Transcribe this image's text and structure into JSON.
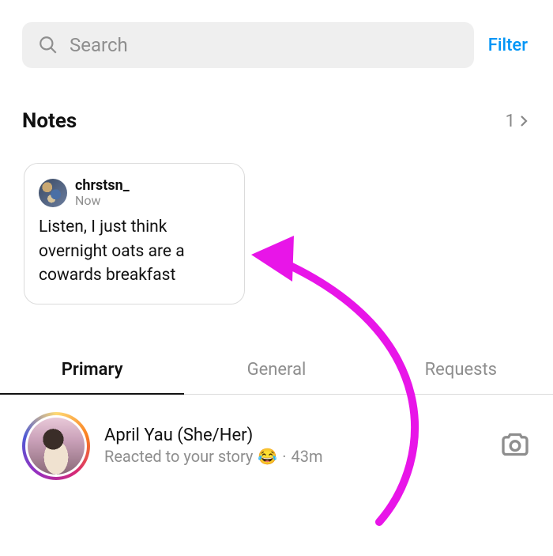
{
  "search": {
    "placeholder": "Search"
  },
  "filter_label": "Filter",
  "notes": {
    "title": "Notes",
    "count": "1",
    "card": {
      "username": "chrstsn_",
      "time": "Now",
      "body": "Listen, I just think overnight oats are a cowards breakfast"
    }
  },
  "tabs": {
    "primary": "Primary",
    "general": "General",
    "requests": "Requests"
  },
  "dm": {
    "name": "April Yau (She/Her)",
    "subtitle": "Reacted to your story",
    "emoji": "😂",
    "sep": "·",
    "time": "43m"
  },
  "colors": {
    "accent": "#0095f6",
    "annot": "#e815e8"
  }
}
